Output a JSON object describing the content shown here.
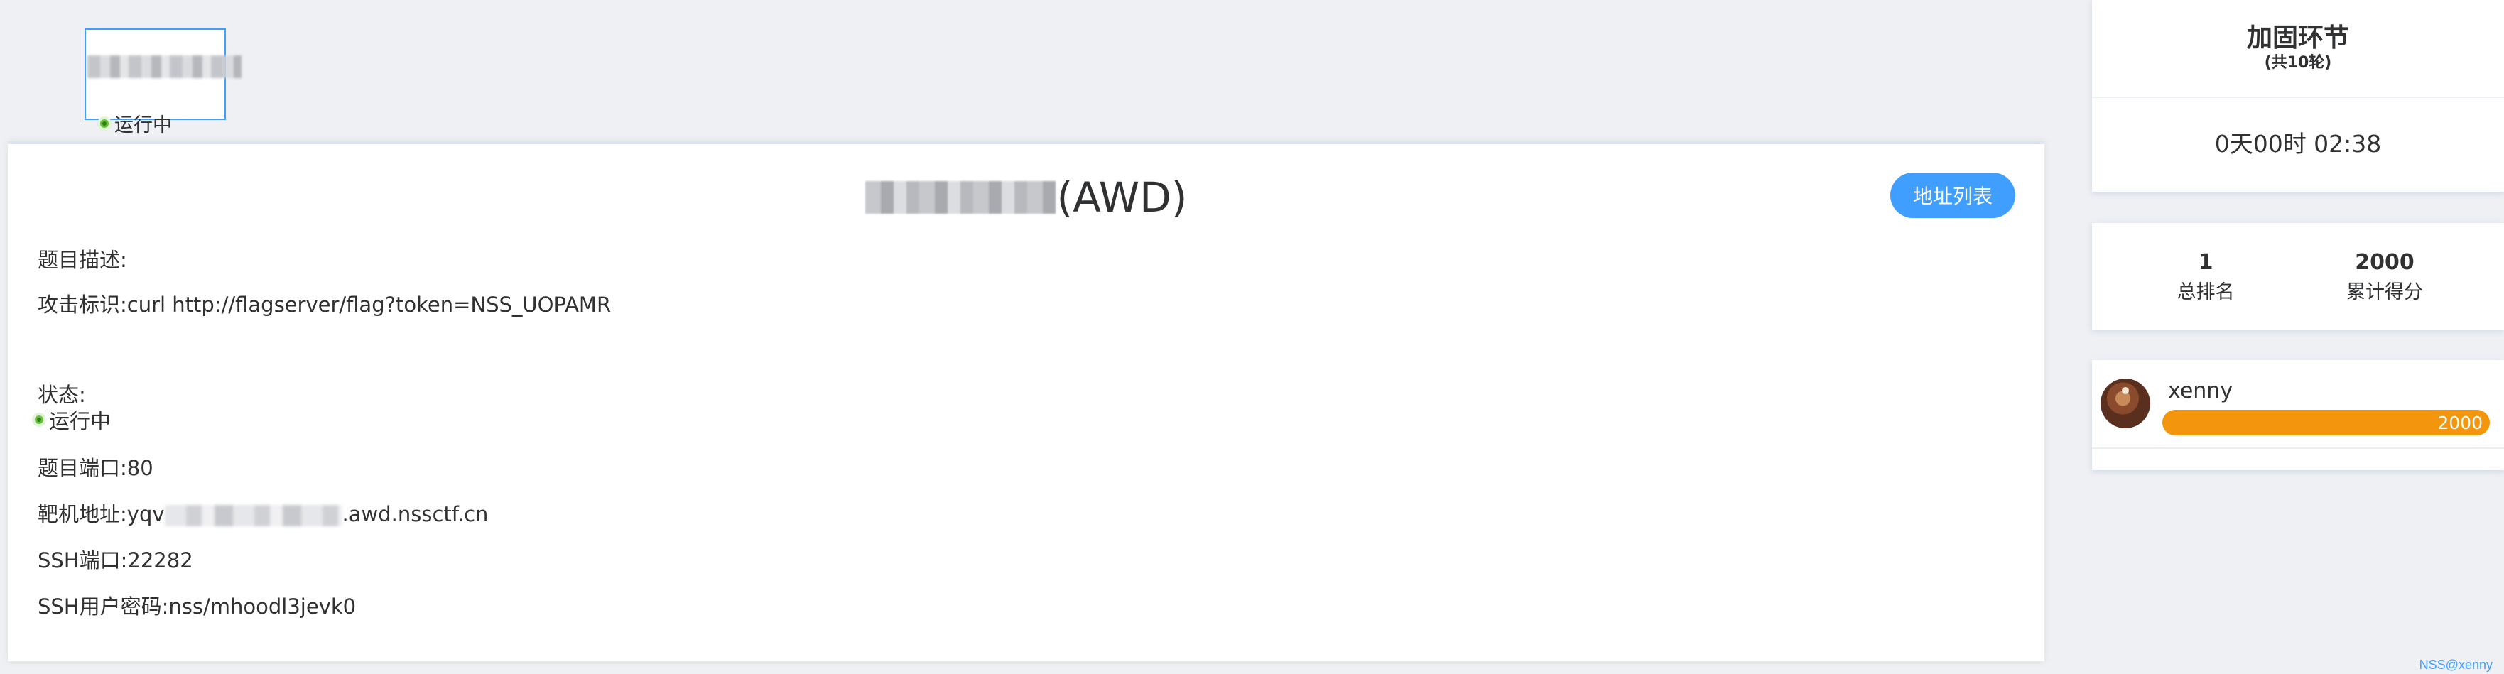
{
  "challenge_card": {
    "status": "运行中"
  },
  "main": {
    "title_suffix": "(AWD)",
    "address_button": "地址列表",
    "description_label": "题目描述:",
    "attack_label": "攻击标识:",
    "attack_value": "curl http://flagserver/flag?token=NSS_UOPAMR",
    "status_label": "状态:",
    "status_value": "运行中",
    "port_label": "题目端口:",
    "port_value": "80",
    "target_label": "靶机地址:",
    "target_prefix": "yqv",
    "target_suffix": ".awd.nssctf.cn",
    "ssh_port_label": "SSH端口:",
    "ssh_port_value": "22282",
    "ssh_cred_label": "SSH用户密码:",
    "ssh_cred_value": "nss/mhoodl3jevk0"
  },
  "round": {
    "title": "加固环节",
    "subtitle": "(共10轮)",
    "timer": "0天00时 02:38"
  },
  "stats": {
    "rank_value": "1",
    "rank_label": "总排名",
    "score_value": "2000",
    "score_label": "累计得分"
  },
  "user": {
    "name": "xenny",
    "score": "2000",
    "score_fraction": 1.0,
    "bar_color": "#f3950d"
  },
  "footer": {
    "text": "NSS@xenny"
  },
  "colors": {
    "primary": "#409eff",
    "success": "#67c23a",
    "warning": "#f3950d"
  }
}
